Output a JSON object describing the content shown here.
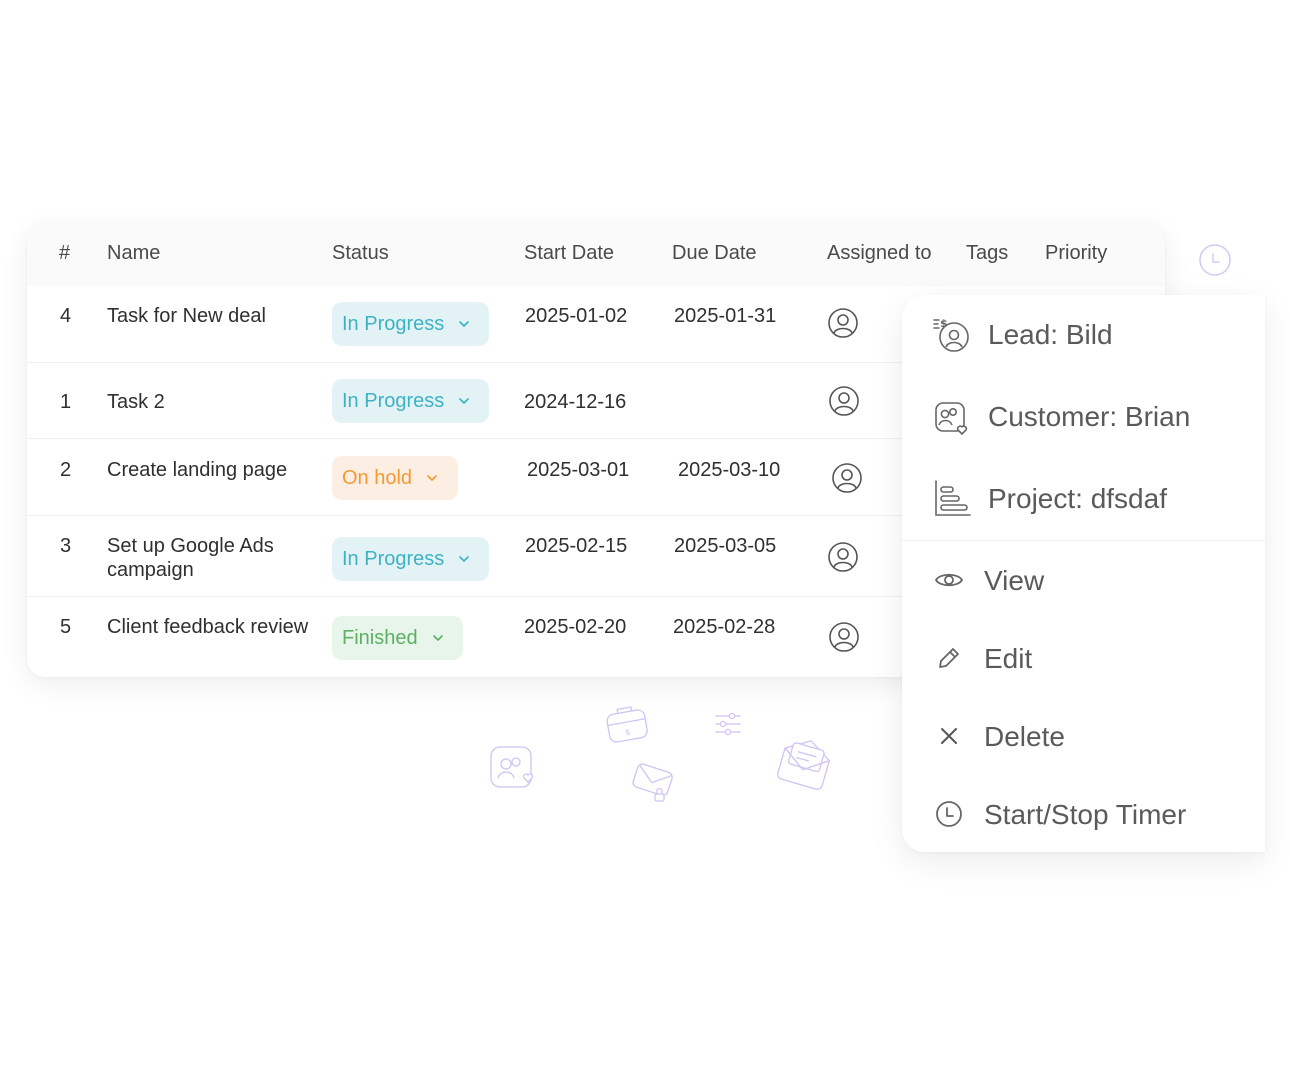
{
  "table": {
    "headers": {
      "num": "#",
      "name": "Name",
      "status": "Status",
      "start": "Start Date",
      "due": "Due Date",
      "assigned": "Assigned to",
      "tags": "Tags",
      "priority": "Priority"
    },
    "rows": [
      {
        "num": "4",
        "name": "Task for New deal",
        "status": "In Progress",
        "start": "2025-01-02",
        "due": "2025-01-31"
      },
      {
        "num": "1",
        "name": "Task 2",
        "status": "In Progress",
        "start": "2024-12-16",
        "due": ""
      },
      {
        "num": "2",
        "name": "Create landing page",
        "status": "On hold",
        "start": "2025-03-01",
        "due": "2025-03-10"
      },
      {
        "num": "3",
        "name": "Set up Google Ads campaign",
        "status": "In Progress",
        "start": "2025-02-15",
        "due": "2025-03-05"
      },
      {
        "num": "5",
        "name": "Client feedback review",
        "status": "Finished",
        "start": "2025-02-20",
        "due": "2025-02-28"
      }
    ]
  },
  "context_menu": {
    "lead": "Lead: Bild",
    "customer": "Customer: Brian",
    "project": "Project: dfsdaf",
    "view": "View",
    "edit": "Edit",
    "delete": "Delete",
    "timer": "Start/Stop Timer"
  },
  "colors": {
    "in_progress_bg": "#e3f3f5",
    "in_progress_text": "#3db2c4",
    "on_hold_bg": "#fdeee3",
    "on_hold_text": "#f39a33",
    "finished_bg": "#e8f5ea",
    "finished_text": "#5cb066",
    "decor_accent": "#c9b6f2"
  },
  "icons": {
    "row_avatar": "user-circle-icon",
    "status_dropdown": "chevron-down-icon",
    "lead": "lead-money-user-icon",
    "customer": "customer-group-icon",
    "project": "gantt-project-icon",
    "view": "eye-icon",
    "edit": "pencil-icon",
    "delete": "close-x-icon",
    "timer": "clock-icon"
  }
}
